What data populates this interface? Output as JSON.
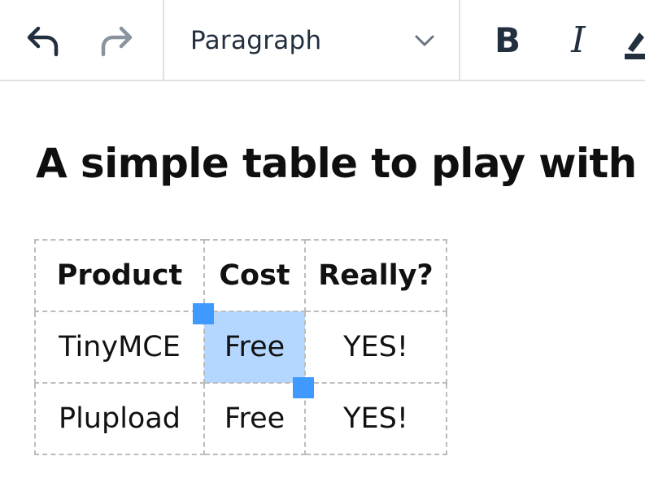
{
  "toolbar": {
    "undo_icon": "undo-icon",
    "redo_icon": "redo-icon",
    "blocks": {
      "value": "Paragraph",
      "icon": "chevron-down-icon"
    },
    "bold_label": "B",
    "italic_label": "I",
    "highlight_icon": "highlight-color-icon",
    "colors": {
      "icon": "#222f3e",
      "icon_disabled": "#8a949e",
      "separator": "#dfe1e4"
    }
  },
  "editor": {
    "heading": "A simple table to play with",
    "table": {
      "headers": [
        "Product",
        "Cost",
        "Really?"
      ],
      "rows": [
        [
          "TinyMCE",
          "Free",
          "YES!"
        ],
        [
          "Plupload",
          "Free",
          "YES!"
        ]
      ],
      "selected_cell": "Free",
      "colors": {
        "selection": "#b4d7ff",
        "handle": "#4099ff",
        "border": "#bcbcbc"
      }
    }
  }
}
